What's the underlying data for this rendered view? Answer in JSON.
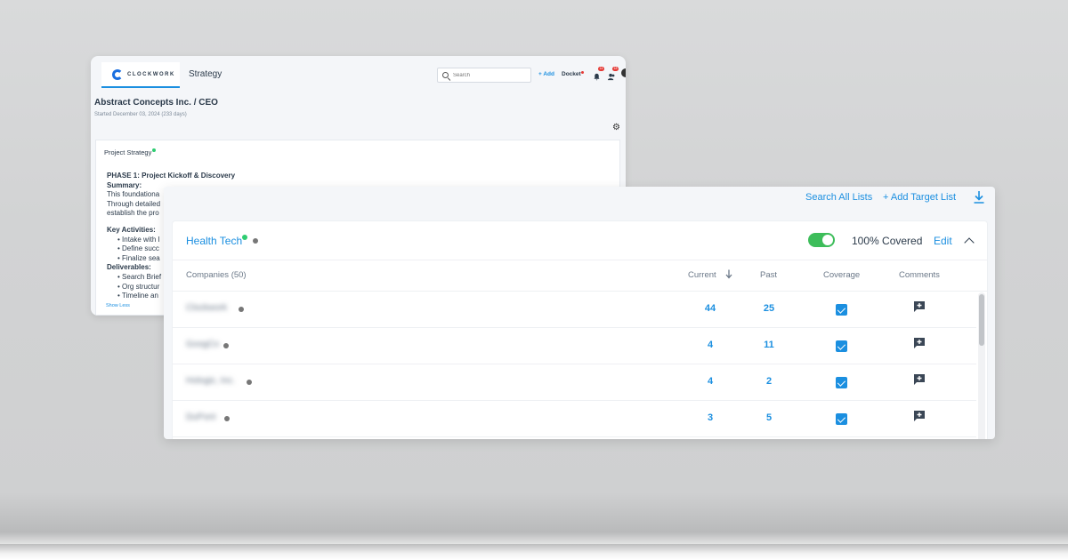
{
  "back_window": {
    "logo_text": "CLOCKWORK",
    "title": "Strategy",
    "search_placeholder": "Search",
    "add_label": "+ Add",
    "docket_label": "Docket",
    "bell_badge": "14",
    "users_badge": "18",
    "company_role": "Abstract Concepts Inc. / CEO",
    "started": "Started December 03, 2024 (233 days)",
    "card_title": "Project Strategy",
    "phase_title": "PHASE 1: Project Kickoff & Discovery",
    "summary_label": "Summary:",
    "summary_lines": [
      "This foundationa",
      "Through detailed",
      "establish the pro"
    ],
    "key_activities_label": "Key Activities:",
    "key_activities": [
      "Intake with I",
      "Define succ",
      "Finalize sea"
    ],
    "deliverables_label": "Deliverables:",
    "deliverables": [
      "Search Brief",
      "Org structur",
      "Timeline an"
    ],
    "show_less": "Show Less"
  },
  "front_panel": {
    "search_all_lists": "Search All Lists",
    "add_target_list": "+ Add Target List",
    "list_name": "Health Tech",
    "coverage_text": "100% Covered",
    "toggle_on": true,
    "edit_label": "Edit",
    "columns": {
      "companies": "Companies (50)",
      "current": "Current",
      "past": "Past",
      "coverage": "Coverage",
      "comments": "Comments"
    },
    "rows": [
      {
        "company": "Clockwork",
        "current": "44",
        "past": "25",
        "covered": true
      },
      {
        "company": "GoogCo",
        "current": "4",
        "past": "11",
        "covered": true
      },
      {
        "company": "Hologic, Inc.",
        "current": "4",
        "past": "2",
        "covered": true
      },
      {
        "company": "DuPont",
        "current": "3",
        "past": "5",
        "covered": true
      }
    ]
  },
  "colors": {
    "accent": "#1b8fe0",
    "toggle_green": "#3dbd5a",
    "status_green": "#2ecc71"
  }
}
